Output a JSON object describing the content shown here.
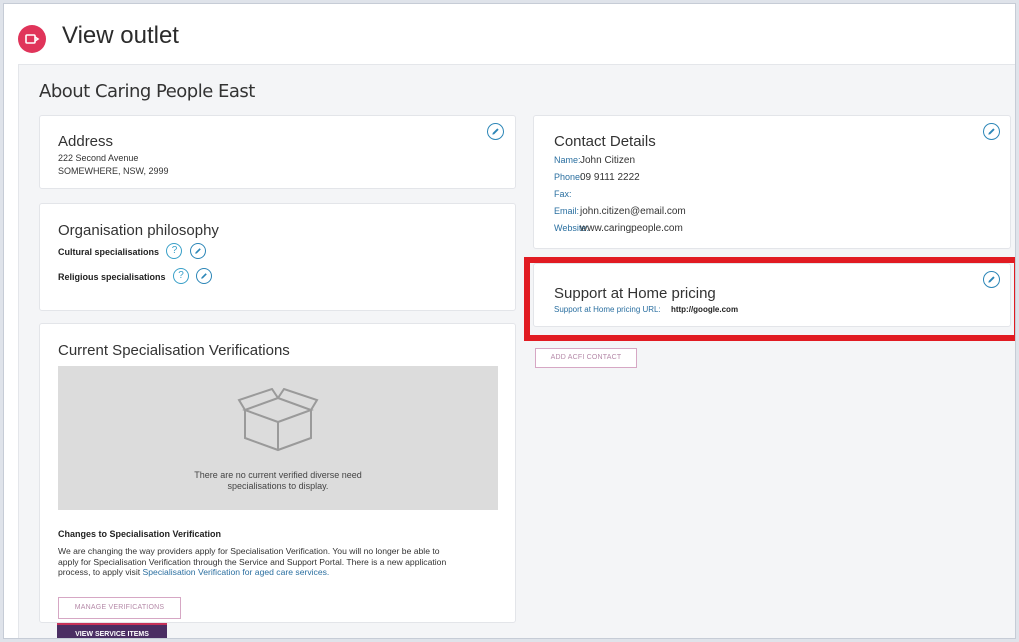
{
  "header": {
    "title": "View outlet"
  },
  "about": {
    "heading": "About Caring People East"
  },
  "address": {
    "title": "Address",
    "line1": "222 Second Avenue",
    "line2": "SOMEWHERE, NSW, 2999"
  },
  "philosophy": {
    "title": "Organisation philosophy",
    "cultural_label": "Cultural specialisations",
    "religious_label": "Religious specialisations"
  },
  "verifications": {
    "title": "Current Specialisation Verifications",
    "empty_line1": "There are no current verified diverse need",
    "empty_line2": "specialisations to display.",
    "changes_heading": "Changes to Specialisation Verification",
    "changes_text_1": "We are changing the way providers apply for Specialisation Verification. You will no longer be able to",
    "changes_text_2": "apply for Specialisation Verification through the Service and Support Portal. There is a new application",
    "changes_text_3": "process, to apply visit ",
    "changes_link": "Specialisation Verification for aged care services.",
    "manage_button": "MANAGE VERIFICATIONS"
  },
  "contact": {
    "title": "Contact Details",
    "rows": [
      {
        "key": "Name:",
        "value": "John Citizen"
      },
      {
        "key": "Phone:",
        "value": "09 9111 2222"
      },
      {
        "key": "Fax:",
        "value": ""
      },
      {
        "key": "Email:",
        "value": "john.citizen@email.com"
      },
      {
        "key": "Website:",
        "value": "www.caringpeople.com"
      }
    ]
  },
  "pricing": {
    "title": "Support at Home pricing",
    "url_label": "Support at Home pricing URL:",
    "url_value": "http://google.com"
  },
  "buttons": {
    "add_acfi": "ADD ACFI CONTACT",
    "view_service_items": "VIEW SERVICE ITEMS"
  },
  "colors": {
    "logo": "#e0345a",
    "accent_blue": "#2c86b7",
    "highlight_red": "#e11b22",
    "button_purple": "#4b2e63"
  },
  "icons": [
    "outlet-logo-icon",
    "pencil-edit-icon",
    "help-question-icon",
    "empty-box-icon"
  ]
}
